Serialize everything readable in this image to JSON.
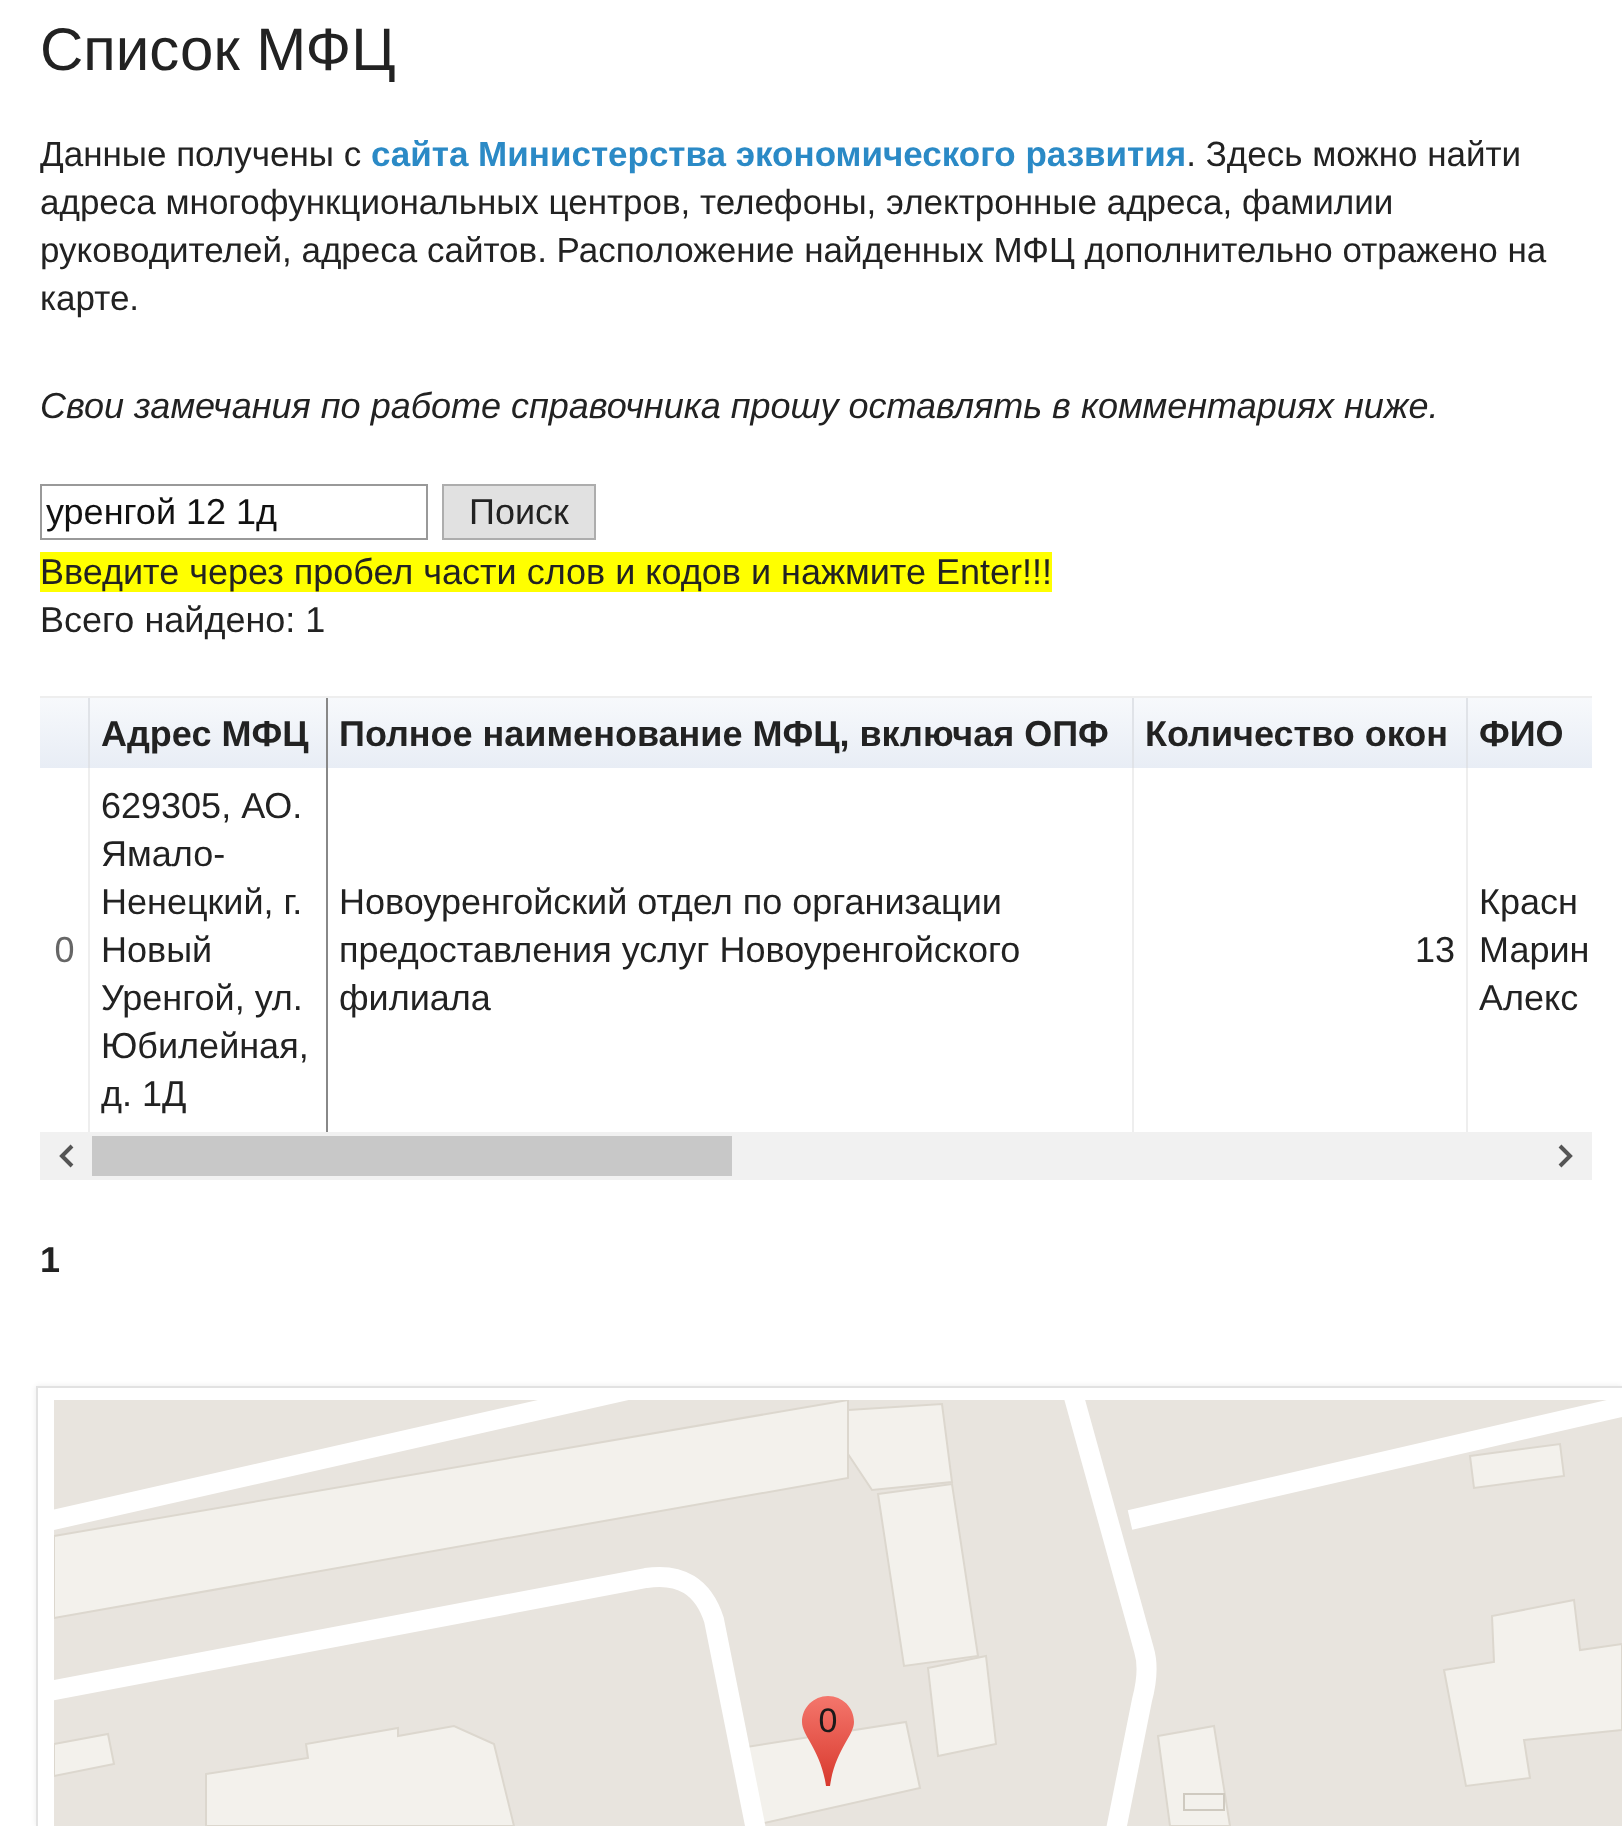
{
  "page": {
    "title": "Список МФЦ"
  },
  "intro": [
    {
      "kind": "text",
      "text": "Данные получены с "
    },
    {
      "kind": "link",
      "text": "сайта Министерства экономического развития"
    },
    {
      "kind": "text",
      "text": ". Здесь можно найти адреса многофункциональных центров, телефоны, электронные адреса, фамилии руководителей, адреса сайтов. Расположение найденных МФЦ дополнительно отражено на карте."
    }
  ],
  "note": "Свои замечания по работе справочника прошу оставлять в комментариях ниже.",
  "search": {
    "value": "уренгой 12 1д",
    "button": "Поиск",
    "hint": "Введите через пробел части слов и кодов и нажмите Enter!!!",
    "total": "Всего найдено: 1"
  },
  "table": {
    "columns": [
      "Адрес МФЦ",
      "Полное наименование МФЦ, включая ОПФ",
      "Количество окон",
      "ФИО"
    ],
    "rows": [
      {
        "index": "0",
        "cells": [
          "629305, АО. Ямало-Ненецкий, г. Новый Уренгой, ул. Юбилейная, д. 1Д",
          "Новоуренгойский отдел по организации предоставления услуг Новоуренгойского филиала",
          "13",
          "Красн\nМарин\nАлекс"
        ]
      }
    ]
  },
  "pagination": [
    {
      "label": "1",
      "selected": true
    }
  ],
  "map": {
    "markers": [
      {
        "label": "0"
      }
    ]
  }
}
